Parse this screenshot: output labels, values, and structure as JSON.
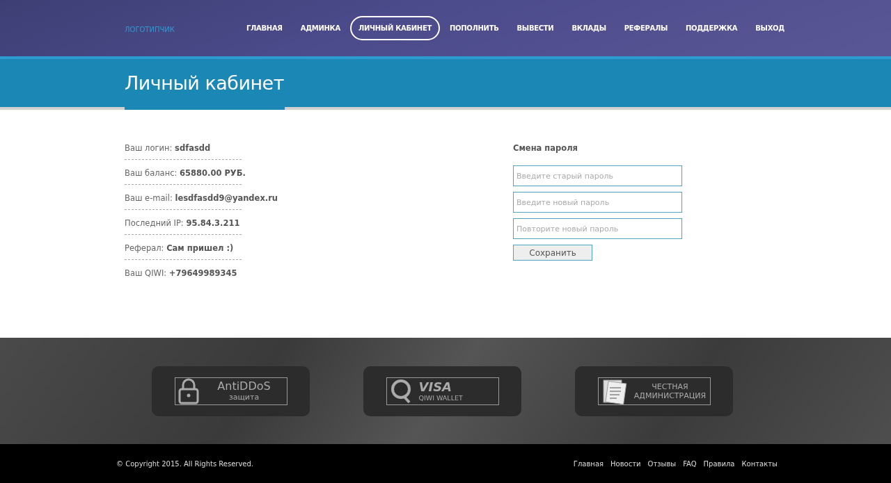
{
  "header": {
    "logo": "ЛОГОТИПЧИК",
    "nav": [
      {
        "label": "ГЛАВНАЯ",
        "selected": false
      },
      {
        "label": "АДМИНКА",
        "selected": false
      },
      {
        "label": "ЛИЧНЫЙ КАБИНЕТ",
        "selected": true
      },
      {
        "label": "ПОПОЛНИТЬ",
        "selected": false
      },
      {
        "label": "ВЫВЕСТИ",
        "selected": false
      },
      {
        "label": "ВКЛАДЫ",
        "selected": false
      },
      {
        "label": "РЕФЕРАЛЫ",
        "selected": false
      },
      {
        "label": "ПОДДЕРЖКА",
        "selected": false
      },
      {
        "label": "ВЫХОД",
        "selected": false
      }
    ]
  },
  "page_title": "Личный кабинет",
  "account_info": [
    {
      "label": "Ваш логин:",
      "value": "sdfasdd"
    },
    {
      "label": "Ваш баланс:",
      "value": "65880.00 РУБ."
    },
    {
      "label": "Ваш e-mail:",
      "value": "lesdfasdd9@yandex.ru"
    },
    {
      "label": "Последний IP:",
      "value": "95.84.3.211"
    },
    {
      "label": "Реферал:",
      "value": "Сам пришел :)"
    },
    {
      "label": "Ваш QIWI:",
      "value": "+79649989345"
    }
  ],
  "password_change": {
    "title": "Смена пароля",
    "fields": [
      {
        "placeholder": "Введите старый пароль"
      },
      {
        "placeholder": "Введите новый пароль"
      },
      {
        "placeholder": "Повторите новый пароль"
      }
    ],
    "button": "Сохранить"
  },
  "badges": [
    {
      "kind": "lock",
      "line_1": "AntiDDoS",
      "line_2": "защита"
    },
    {
      "kind": "qiwi",
      "line_1": "VISA",
      "line_2": "QIWI WALLET"
    },
    {
      "kind": "document",
      "line_1": "ЧЕСТНАЯ",
      "line_2": "АДМИНИСТРАЦИЯ"
    }
  ],
  "footer": {
    "copyright": "© Copyright 2015. All Rights Reserved.",
    "links": [
      "Главная",
      "Новости",
      "Отзывы",
      "FAQ",
      "Правила",
      "Контакты"
    ]
  }
}
